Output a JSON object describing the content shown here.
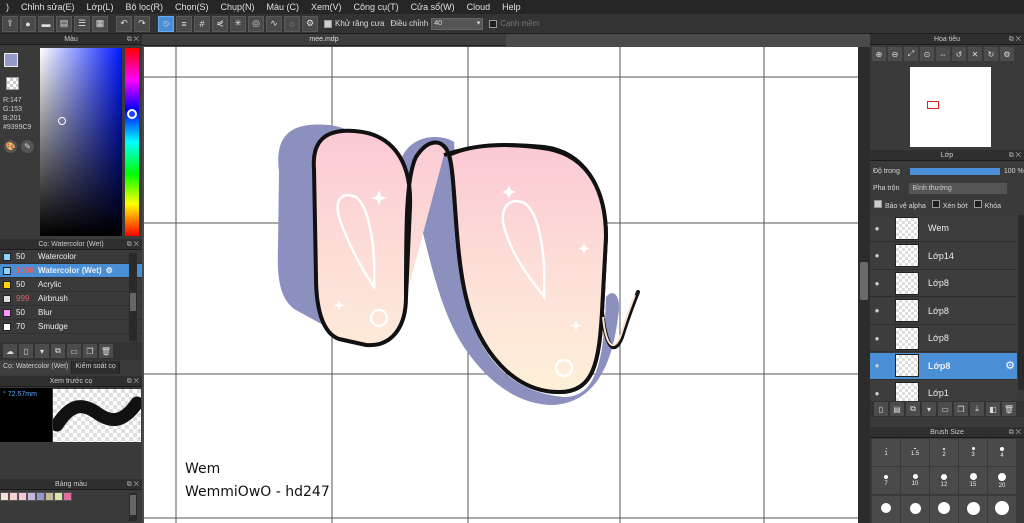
{
  "menu": [
    "Chỉnh sửa(E)",
    "Lớp(L)",
    "Bộ lọc(R)",
    "Chọn(S)",
    "Chụp(N)",
    "Màu (C)",
    "Xem(V)",
    "Công cụ(T)",
    "Cửa sổ(W)",
    "Cloud",
    "Help"
  ],
  "toolbar": {
    "antialias_label": "Khử răng cưa",
    "adjust_label": "Điều chỉnh",
    "adjust_value": "40",
    "soft_edge_label": "Cạnh mềm"
  },
  "color_panel": {
    "title": "Màu",
    "r": "R:147",
    "g": "G:153",
    "b": "B:201",
    "hex": "#9399C9",
    "main_color": "#9399c9",
    "sub_color": "#f7e2d8"
  },
  "brush_panel": {
    "title": "Cọ: Watercolor (Wet)",
    "brushes": [
      {
        "size": "50",
        "name": "Watercolor",
        "color": "#8fd3ff"
      },
      {
        "size": "1000",
        "name": "Watercolor (Wet)",
        "color": "#8fd3ff",
        "selected": true
      },
      {
        "size": "50",
        "name": "Acrylic",
        "color": "#ffd700"
      },
      {
        "size": "999",
        "name": "Airbrush",
        "color": "#dddddd"
      },
      {
        "size": "50",
        "name": "Blur",
        "color": "#ff99ff"
      },
      {
        "size": "70",
        "name": "Smudge",
        "color": "#ffffff"
      }
    ],
    "tab1": "Cọ: Watercolor (Wet)",
    "tab2": "Kiểm soát cọ"
  },
  "preview_panel": {
    "title": "Xem trước cọ",
    "size": "72.57mm"
  },
  "palette_panel": {
    "title": "Bảng màu",
    "colors": [
      "#f7e2d8",
      "#fbd0d0",
      "#f3c9d8",
      "#c6b7e0",
      "#9399c9",
      "#c5b79b",
      "#d8e8a8",
      "#e070a0"
    ]
  },
  "canvas": {
    "doc_title": "mee.mdp",
    "watermark_line1": "Wem",
    "watermark_line2": "WemmiOwO - hd247"
  },
  "navigator": {
    "title": "Hoa tiêu"
  },
  "layer_panel": {
    "title": "Lớp",
    "opacity_label": "Độ trong",
    "opacity_value": "100 %",
    "blend_label": "Pha trộn",
    "blend_value": "Bình thường",
    "protect_alpha": "Bảo vệ alpha",
    "clipping": "Xén bớt",
    "lock": "Khóa",
    "layers": [
      "Wem",
      "Lớp14",
      "Lớp8",
      "Lớp8",
      "Lớp8",
      "Lớp8",
      "Lớp1"
    ]
  },
  "brush_size_panel": {
    "title": "Brush Size",
    "sizes_row1": [
      "1",
      "1.5",
      "2",
      "3",
      "4"
    ],
    "sizes_row2": [
      "7",
      "10",
      "12",
      "15",
      "20"
    ]
  }
}
